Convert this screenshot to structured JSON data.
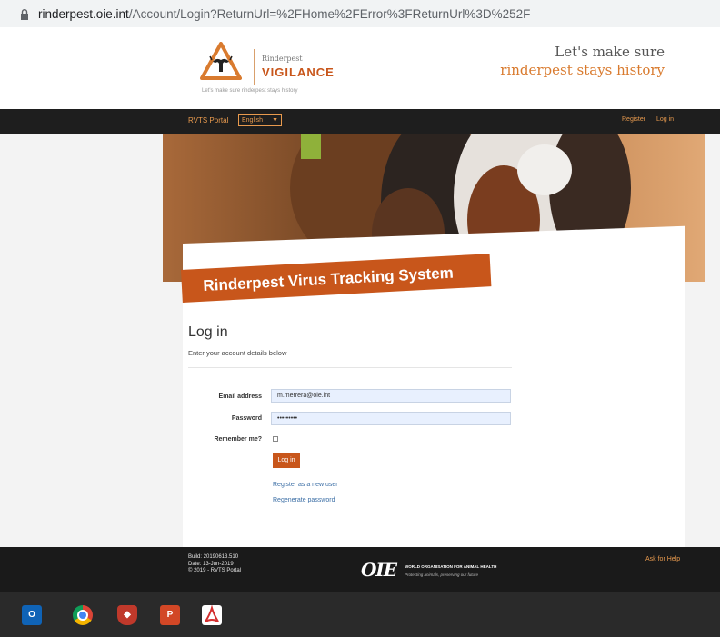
{
  "browser": {
    "url_domain": "rinderpest.oie.int",
    "url_path": "/Account/Login?ReturnUrl=%2FHome%2FError%3FReturnUrl%3D%252F"
  },
  "header": {
    "logo_name": "Rinderpest",
    "logo_vigilance": "VIGILANCE",
    "logo_tagline": "Let's make sure rinderpest stays history",
    "slogan_line1": "Let's make sure",
    "slogan_line2": "rinderpest stays history"
  },
  "nav": {
    "portal": "RVTS Portal",
    "language": "English",
    "register": "Register",
    "login": "Log in"
  },
  "banner": {
    "title": "Rinderpest Virus Tracking System"
  },
  "form": {
    "title": "Log in",
    "subtitle": "Enter your account details below",
    "email_label": "Email address",
    "email_value": "m.merrera@oie.int",
    "password_label": "Password",
    "password_value": "•••••••••",
    "remember_label": "Remember me?",
    "submit_label": "Log in",
    "register_link": "Register as a new user",
    "reset_link": "Regenerate password"
  },
  "footer": {
    "build": "Build: 20190613.510",
    "date": "Date: 13-Jun-2019",
    "copyright": "© 2019 - RVTS Portal",
    "oie_logo": "OIE",
    "oie_name": "WORLD ORGANISATION FOR ANIMAL HEALTH",
    "oie_motto": "Protecting animals, preserving our future",
    "help": "Ask for Help"
  },
  "taskbar": {
    "apps": [
      "outlook-icon",
      "chrome-icon",
      "shield-icon",
      "powerpoint-icon",
      "pdf-icon"
    ]
  },
  "colors": {
    "brand_orange": "#c8561b",
    "nav_bg": "#1e1e1e",
    "link_orange": "#e89a4e"
  }
}
